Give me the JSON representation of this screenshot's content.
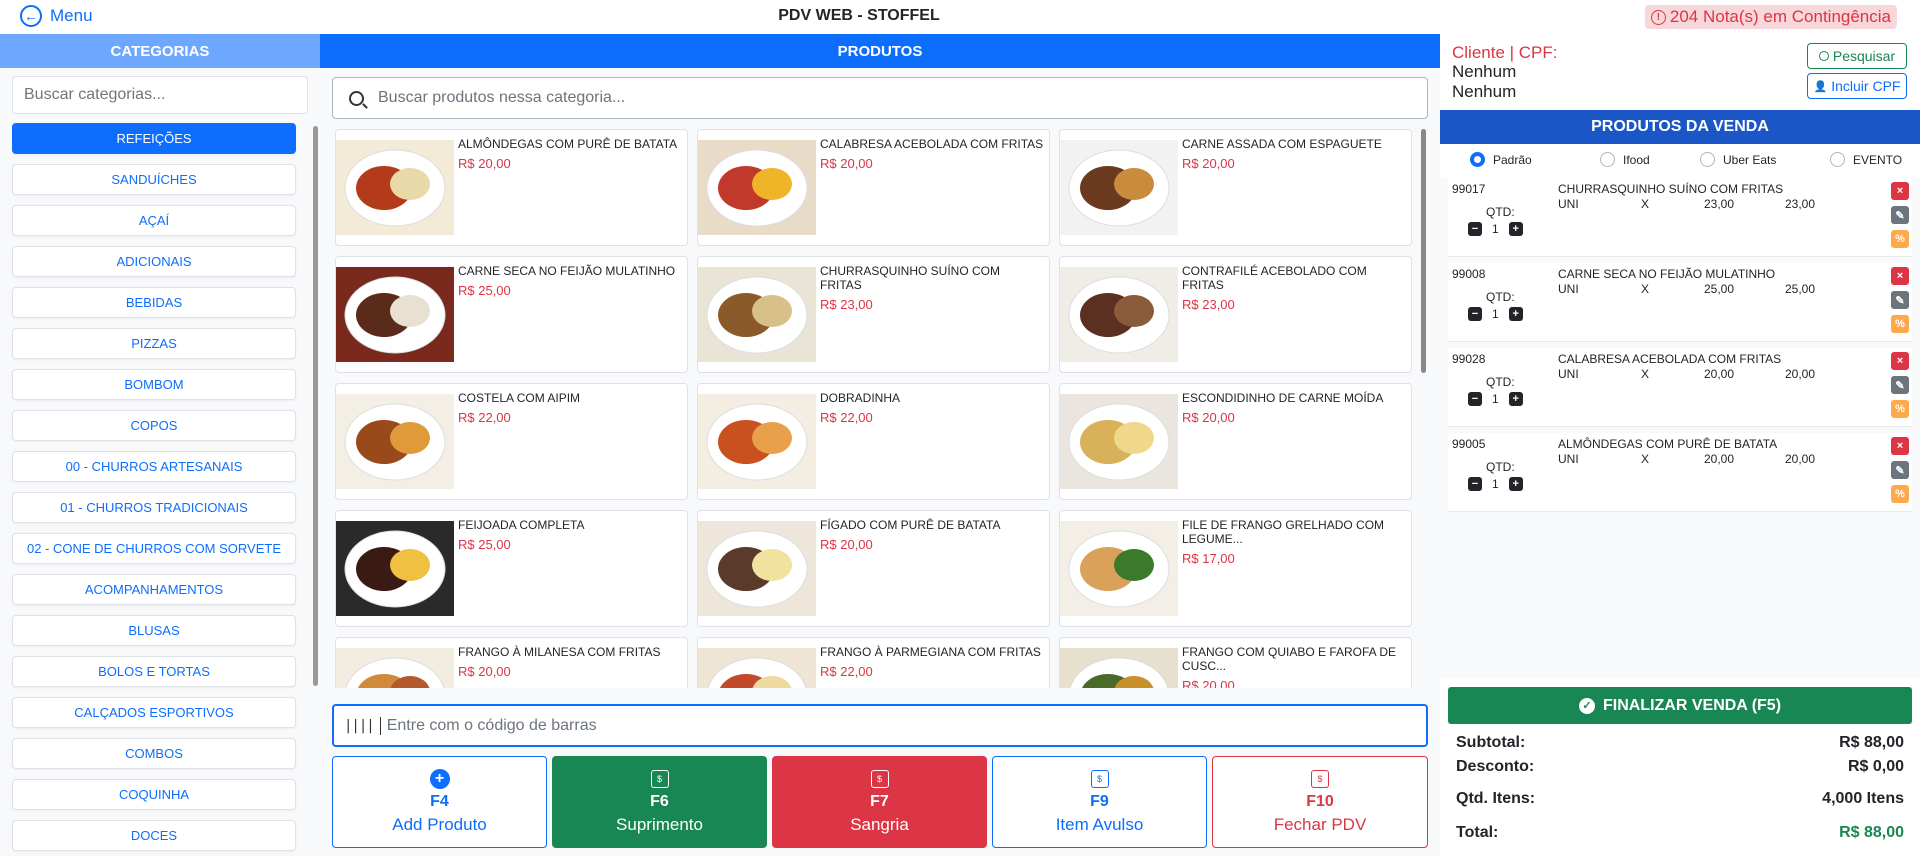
{
  "topbar": {
    "menu_label": "Menu",
    "title": "PDV WEB - STOFFEL",
    "contingencia": "204 Nota(s) em Contingência"
  },
  "sidebar": {
    "header": "CATEGORIAS",
    "search_placeholder": "Buscar categorias...",
    "categories": [
      "REFEIÇÕES",
      "SANDUÍCHES",
      "AÇAÍ",
      "ADICIONAIS",
      "BEBIDAS",
      "PIZZAS",
      "BOMBOM",
      "COPOS",
      "00 - CHURROS ARTESANAIS",
      "01 - CHURROS TRADICIONAIS",
      "02 - CONE DE CHURROS COM SORVETE",
      "ACOMPANHAMENTOS",
      "BLUSAS",
      "BOLOS E TORTAS",
      "CALÇADOS ESPORTIVOS",
      "COMBOS",
      "COQUINHA",
      "DOCES"
    ],
    "active_index": 0
  },
  "products": {
    "header": "PRODUTOS",
    "search_placeholder": "Buscar produtos nessa categoria...",
    "items": [
      {
        "name": "ALMÔNDEGAS COM PURÊ DE BATATA",
        "price": "R$ 20,00"
      },
      {
        "name": "CALABRESA ACEBOLADA COM FRITAS",
        "price": "R$ 20,00"
      },
      {
        "name": "CARNE ASSADA COM ESPAGUETE",
        "price": "R$ 20,00"
      },
      {
        "name": "CARNE SECA NO FEIJÃO MULATINHO",
        "price": "R$ 25,00"
      },
      {
        "name": "CHURRASQUINHO SUÍNO COM FRITAS",
        "price": "R$ 23,00"
      },
      {
        "name": "CONTRAFILÉ ACEBOLADO COM FRITAS",
        "price": "R$ 23,00"
      },
      {
        "name": "COSTELA COM AIPIM",
        "price": "R$ 22,00"
      },
      {
        "name": "DOBRADINHA",
        "price": "R$ 22,00"
      },
      {
        "name": "ESCONDIDINHO DE CARNE MOÍDA",
        "price": "R$ 20,00"
      },
      {
        "name": "FEIJOADA COMPLETA",
        "price": "R$ 25,00"
      },
      {
        "name": "FÍGADO COM PURÊ DE BATATA",
        "price": "R$ 20,00"
      },
      {
        "name": "FILE DE FRANGO GRELHADO COM LEGUME...",
        "price": "R$ 17,00"
      },
      {
        "name": "FRANGO À MILANESA COM FRITAS",
        "price": "R$ 20,00"
      },
      {
        "name": "FRANGO À PARMEGIANA COM FRITAS",
        "price": "R$ 22,00"
      },
      {
        "name": "FRANGO COM QUIABO E FAROFA DE CUSC...",
        "price": "R$ 20,00"
      }
    ],
    "barcode_placeholder": "Entre com o código de barras"
  },
  "fkeys": [
    {
      "key": "F4",
      "label": "Add Produto"
    },
    {
      "key": "F6",
      "label": "Suprimento"
    },
    {
      "key": "F7",
      "label": "Sangria"
    },
    {
      "key": "F9",
      "label": "Item Avulso"
    },
    {
      "key": "F10",
      "label": "Fechar PDV"
    }
  ],
  "client": {
    "label": "Cliente | CPF:",
    "name": "Nenhum",
    "cpf": "Nenhum",
    "search_button": "Pesquisar",
    "add_cpf_button": "Incluir CPF"
  },
  "sale": {
    "header": "PRODUTOS DA VENDA",
    "channels": [
      "Padrão",
      "Ifood",
      "Uber Eats",
      "EVENTO"
    ],
    "selected_channel": 0,
    "qtd_label": "QTD:",
    "items": [
      {
        "code": "99017",
        "name": "CHURRASQUINHO SUÍNO COM FRITAS",
        "unit": "UNI",
        "x": "X",
        "price": "23,00",
        "total": "23,00",
        "qty": "1"
      },
      {
        "code": "99008",
        "name": "CARNE SECA NO FEIJÃO MULATINHO",
        "unit": "UNI",
        "x": "X",
        "price": "25,00",
        "total": "25,00",
        "qty": "1"
      },
      {
        "code": "99028",
        "name": "CALABRESA ACEBOLADA COM FRITAS",
        "unit": "UNI",
        "x": "X",
        "price": "20,00",
        "total": "20,00",
        "qty": "1"
      },
      {
        "code": "99005",
        "name": "ALMÔNDEGAS COM PURÊ DE BATATA",
        "unit": "UNI",
        "x": "X",
        "price": "20,00",
        "total": "20,00",
        "qty": "1"
      }
    ],
    "finalize_button": "FINALIZAR VENDA (F5)",
    "totals": {
      "subtotal_label": "Subtotal:",
      "subtotal": "R$ 88,00",
      "desconto_label": "Desconto:",
      "desconto": "R$ 0,00",
      "qtd_label": "Qtd. Itens:",
      "qtd": "4,000 Itens",
      "total_label": "Total:",
      "total": "R$ 88,00"
    }
  },
  "colors": {
    "primary": "#0d6efd",
    "success": "#198754",
    "danger": "#dc3545",
    "sidebar_header": "#6ea8fe"
  }
}
